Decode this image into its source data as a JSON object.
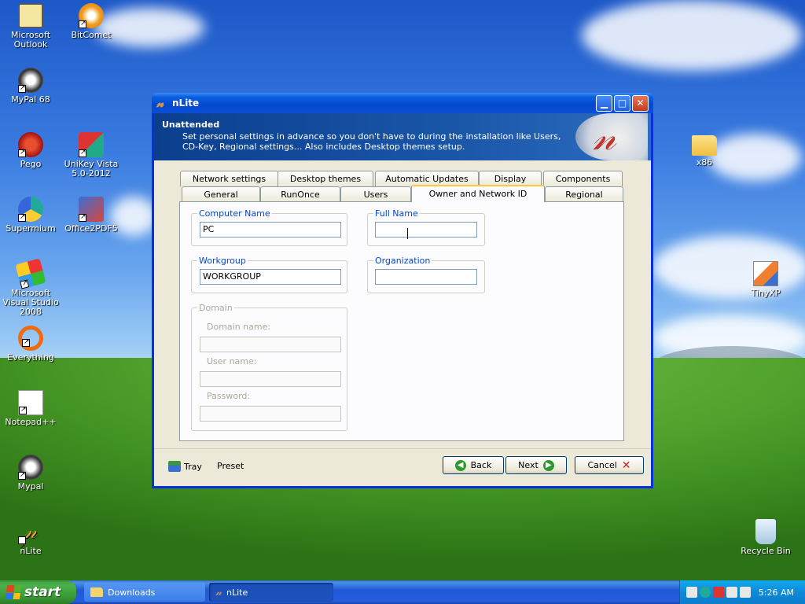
{
  "desktop": {
    "icons": [
      {
        "label": "Microsoft Outlook",
        "icon": "outlook-icon"
      },
      {
        "label": "BitComet",
        "icon": "bitcomet-icon"
      },
      {
        "label": "MyPal 68",
        "icon": "mypal-icon"
      },
      {
        "label": "Pego",
        "icon": "pego-icon"
      },
      {
        "label": "UniKey Vista 5.0-2012",
        "icon": "unikey-icon"
      },
      {
        "label": "Supermium",
        "icon": "supermium-icon"
      },
      {
        "label": "Office2PDF5",
        "icon": "office2pdf-icon"
      },
      {
        "label": "Microsoft Visual Studio 2008",
        "icon": "visual-studio-icon"
      },
      {
        "label": "Everything",
        "icon": "everything-icon"
      },
      {
        "label": "Notepad++",
        "icon": "notepadpp-icon"
      },
      {
        "label": "Mypal",
        "icon": "mypal-icon"
      },
      {
        "label": "nLite",
        "icon": "nlite-icon"
      },
      {
        "label": "x86",
        "icon": "folder-icon"
      },
      {
        "label": "TinyXP",
        "icon": "tinyxp-icon"
      },
      {
        "label": "Recycle Bin",
        "icon": "recycle-bin-icon"
      }
    ]
  },
  "window": {
    "title": "nLite",
    "header": {
      "title": "Unattended",
      "description": "Set personal settings in advance so you don't have to during the installation like Users, CD-Key, Regional settings... Also includes Desktop themes setup."
    },
    "tabs_row1": [
      "Network settings",
      "Desktop themes",
      "Automatic Updates",
      "Display",
      "Components"
    ],
    "tabs_row2": [
      "General",
      "RunOnce",
      "Users",
      "Owner and Network ID",
      "Regional"
    ],
    "active_tab": "Owner and Network ID",
    "computer_name": {
      "label": "Computer Name",
      "value": "PC"
    },
    "full_name": {
      "label": "Full Name",
      "value": ""
    },
    "workgroup": {
      "label": "Workgroup",
      "value": "WORKGROUP"
    },
    "organization": {
      "label": "Organization",
      "value": ""
    },
    "domain": {
      "label": "Domain",
      "domain_name_label": "Domain name:",
      "user_name_label": "User name:",
      "password_label": "Password:"
    },
    "footer": {
      "tray": "Tray",
      "preset": "Preset",
      "back": "Back",
      "next": "Next",
      "cancel": "Cancel"
    }
  },
  "taskbar": {
    "start": "start",
    "tasks": [
      "Downloads",
      "nLite"
    ],
    "clock": "5:26 AM"
  }
}
